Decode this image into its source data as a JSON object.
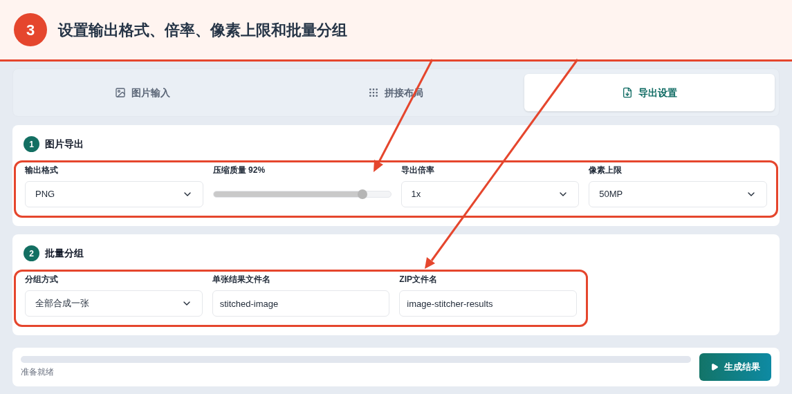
{
  "banner": {
    "step": "3",
    "title": "设置输出格式、倍率、像素上限和批量分组"
  },
  "tabs": [
    {
      "label": "图片输入",
      "selected": false
    },
    {
      "label": "拼接布局",
      "selected": false
    },
    {
      "label": "导出设置",
      "selected": true
    }
  ],
  "sections": [
    {
      "number": "1",
      "title": "图片导出",
      "fields": [
        {
          "kind": "select",
          "label": "输出格式",
          "value": "PNG"
        },
        {
          "kind": "slider",
          "label": "压缩质量 92%",
          "level": 0.84
        },
        {
          "kind": "select",
          "label": "导出倍率",
          "value": "1x"
        },
        {
          "kind": "select",
          "label": "像素上限",
          "value": "50MP"
        }
      ]
    },
    {
      "number": "2",
      "title": "批量分组",
      "fields": [
        {
          "kind": "select",
          "label": "分组方式",
          "value": "全部合成一张"
        },
        {
          "kind": "input",
          "label": "单张结果文件名",
          "value": "stitched-image"
        },
        {
          "kind": "input",
          "label": "ZIP文件名",
          "value": "image-stitcher-results"
        }
      ]
    }
  ],
  "footer": {
    "status": "准备就绪",
    "button": "生成结果"
  }
}
